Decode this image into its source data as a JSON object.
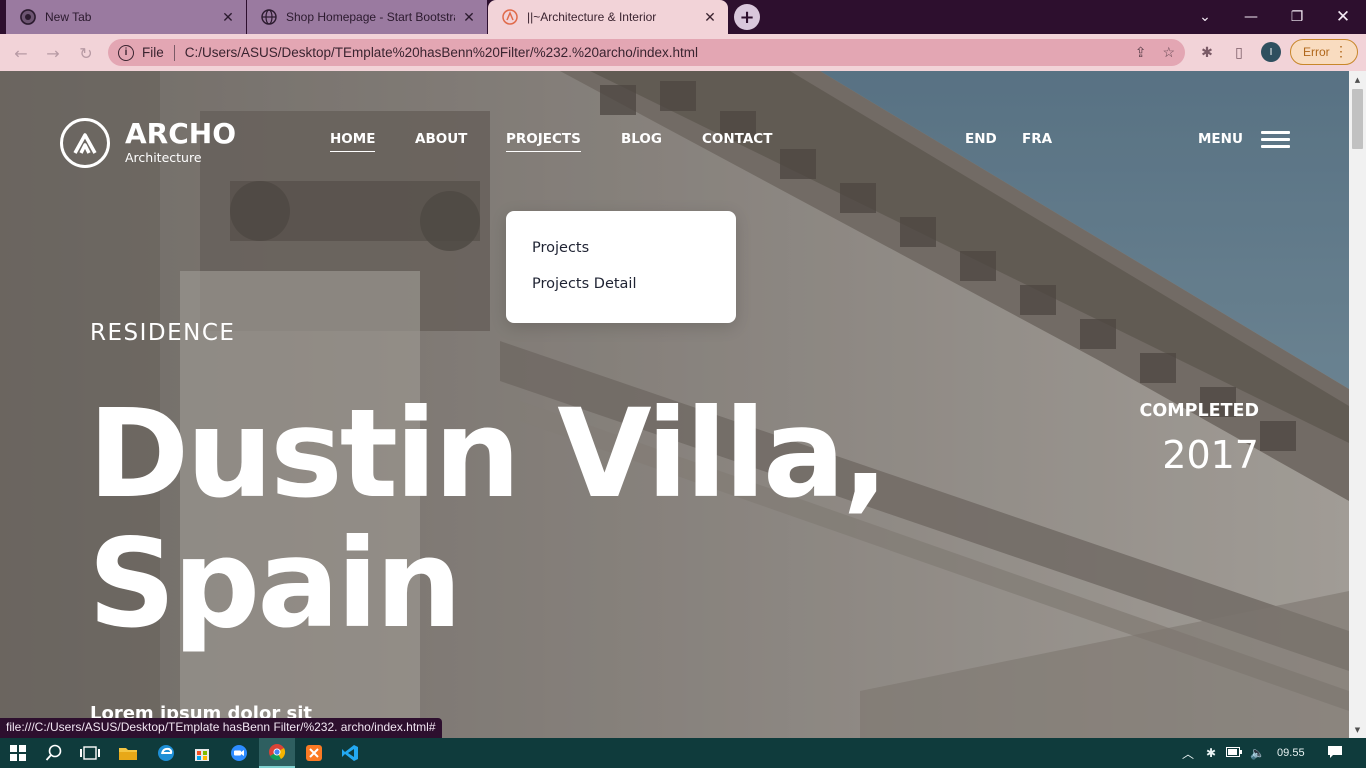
{
  "browser": {
    "tabs": [
      {
        "title": "New Tab",
        "state": "inactive"
      },
      {
        "title": "Shop Homepage - Start Bootstrap",
        "state": "inactive"
      },
      {
        "title": "||~Architecture & Interior",
        "state": "active"
      }
    ],
    "omnibox": {
      "scheme_label": "File",
      "url": "C:/Users/ASUS/Desktop/TEmplate%20hasBenn%20Filter/%232.%20archo/index.html"
    },
    "profile_initial": "I",
    "error_label": "Error",
    "status_url": "file:///C:/Users/ASUS/Desktop/TEmplate hasBenn Filter/%232. archo/index.html#"
  },
  "site": {
    "logo": {
      "name": "ARCHO",
      "tagline": "Architecture"
    },
    "nav": [
      "HOME",
      "ABOUT",
      "PROJECTS",
      "BLOG",
      "CONTACT"
    ],
    "languages": [
      "END",
      "FRA"
    ],
    "menu_label": "MENU",
    "dropdown": [
      "Projects",
      "Projects Detail"
    ]
  },
  "hero": {
    "eyebrow": "RESIDENCE",
    "title_line1": "Dustin Villa,",
    "title_line2": "Spain",
    "completed_label": "COMPLETED",
    "completed_year": "2017",
    "intro": "Lorem ipsum dolor sit"
  },
  "taskbar": {
    "time": "09.55"
  },
  "colors": {
    "tabstrip": "#2d0f2e",
    "toolbar": "#f2d3d8",
    "omnibox": "#e3a6b3",
    "sky": "#7b9aae",
    "taskbar": "#0f3b3c"
  }
}
